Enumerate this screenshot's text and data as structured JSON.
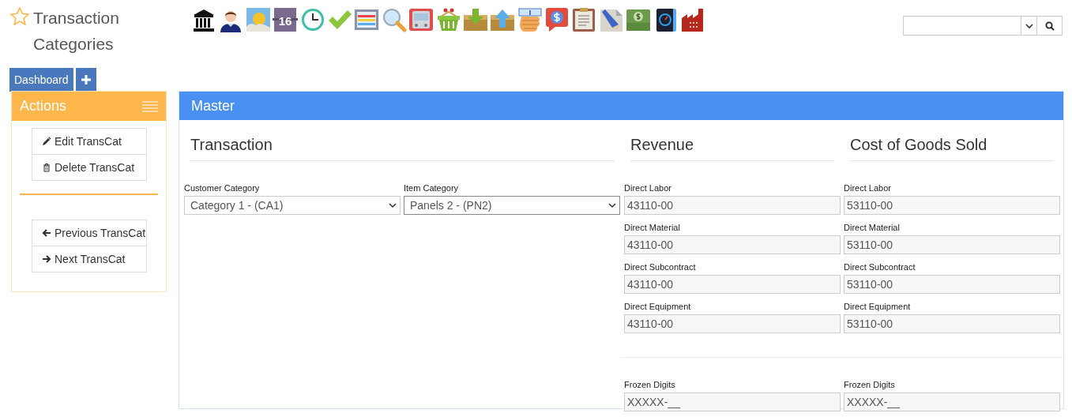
{
  "page_title": "Transaction Categories",
  "favorite": false,
  "nav_buttons": [
    {
      "kind": "text",
      "label": "Dashboard"
    },
    {
      "kind": "add"
    }
  ],
  "toolbar": {
    "calendar_day": "16"
  },
  "actions": {
    "title": "Actions",
    "groups": [
      [
        {
          "kind": "edit",
          "label": "Edit TransCat"
        },
        {
          "kind": "delete",
          "label": "Delete TransCat"
        }
      ],
      [
        {
          "kind": "previous",
          "label": "Previous TransCat"
        },
        {
          "kind": "next",
          "label": "Next TransCat"
        }
      ]
    ]
  },
  "master": {
    "title": "Master",
    "transaction": {
      "heading": "Transaction",
      "selects": [
        {
          "label": "Customer Category",
          "value": "Category 1 - (CA1)",
          "focused": false
        },
        {
          "label": "Item Category",
          "value": "Panels 2 - (PN2)",
          "focused": true
        }
      ]
    },
    "accounts": [
      {
        "heading": "Revenue",
        "fields": [
          {
            "label": "Direct Labor",
            "value": "43110-00"
          },
          {
            "label": "Direct Material",
            "value": "43110-00"
          },
          {
            "label": "Direct Subcontract",
            "value": "43110-00"
          },
          {
            "label": "Direct Equipment",
            "value": "43110-00"
          }
        ],
        "frozen": {
          "label": "Frozen Digits",
          "value": "XXXXX-__"
        }
      },
      {
        "heading": "Cost of Goods Sold",
        "fields": [
          {
            "label": "Direct Labor",
            "value": "53110-00"
          },
          {
            "label": "Direct Material",
            "value": "53110-00"
          },
          {
            "label": "Direct Subcontract",
            "value": "53110-00"
          },
          {
            "label": "Direct Equipment",
            "value": "53110-00"
          }
        ],
        "frozen": {
          "label": "Frozen Digits",
          "value": "XXXXX-__"
        }
      }
    ]
  }
}
